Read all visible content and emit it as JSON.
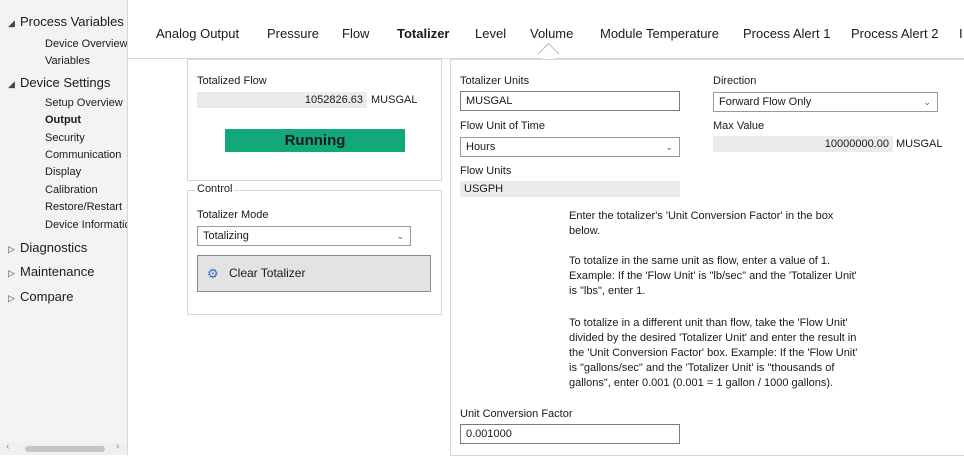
{
  "sidebar": {
    "groups": [
      {
        "label": "Process Variables",
        "expanded": true,
        "children": [
          "Device Overview",
          "Variables"
        ]
      },
      {
        "label": "Device Settings",
        "expanded": true,
        "children": [
          "Setup Overview",
          "Output",
          "Security",
          "Communication",
          "Display",
          "Calibration",
          "Restore/Restart",
          "Device Informatic"
        ]
      },
      {
        "label": "Diagnostics",
        "expanded": false
      },
      {
        "label": "Maintenance",
        "expanded": false
      },
      {
        "label": "Compare",
        "expanded": false
      }
    ],
    "active_item": "Output"
  },
  "tabs": [
    "Analog Output",
    "Pressure",
    "Flow",
    "Totalizer",
    "Level",
    "Volume",
    "Module Temperature",
    "Process Alert 1",
    "Process Alert 2",
    "I"
  ],
  "active_tab": "Totalizer",
  "left_panel": {
    "totalized_flow_label": "Totalized Flow",
    "totalized_flow_value": "1052826.63",
    "totalized_flow_unit": "MUSGAL",
    "status_text": "Running",
    "status_color": "#13a87a"
  },
  "control": {
    "legend": "Control",
    "mode_label": "Totalizer Mode",
    "mode_value": "Totalizing",
    "clear_button": "Clear Totalizer"
  },
  "right_panel": {
    "units_label": "Totalizer Units",
    "units_value": "MUSGAL",
    "time_label": "Flow Unit of Time",
    "time_value": "Hours",
    "flow_units_label": "Flow Units",
    "flow_units_value": "USGPH",
    "direction_label": "Direction",
    "direction_value": "Forward Flow Only",
    "max_label": "Max Value",
    "max_value": "10000000.00",
    "max_unit": "MUSGAL",
    "help_1": "Enter the totalizer's 'Unit Conversion Factor' in the box below.",
    "help_2": "To totalize in the same unit as flow, enter a value of 1. Example: If the 'Flow Unit' is \"lb/sec\" and the 'Totalizer Unit' is \"lbs\", enter 1.",
    "help_3": "To totalize in a different unit than flow, take the 'Flow Unit' divided by the desired 'Totalizer Unit' and enter the result in the 'Unit Conversion Factor' box. Example: If the 'Flow Unit' is \"gallons/sec\" and the 'Totalizer Unit' is \"thousands of gallons\", enter 0.001 (0.001 = 1 gallon / 1000 gallons).",
    "ucf_label": "Unit Conversion Factor",
    "ucf_value": "0.001000"
  }
}
